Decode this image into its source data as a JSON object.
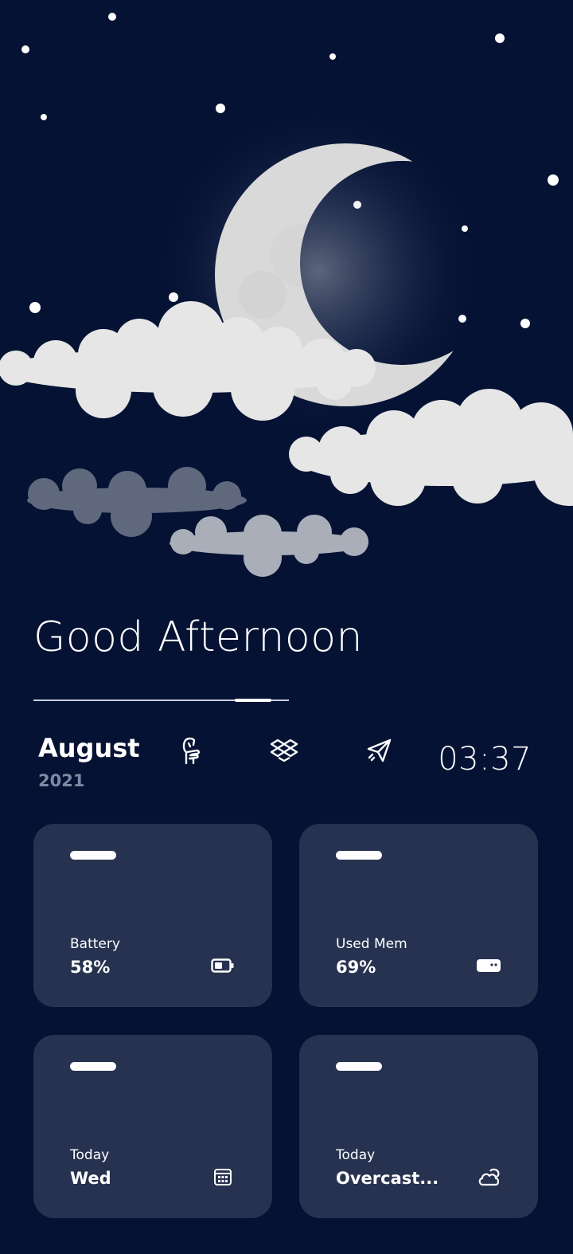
{
  "scene": {
    "description_icon": "crescent-moon-night-sky"
  },
  "greeting": "Good Afternoon",
  "progress": {
    "fraction": 0.86
  },
  "date": {
    "month": "August",
    "year": "2021"
  },
  "apps": [
    {
      "name": "finder-hand-icon"
    },
    {
      "name": "dropbox-icon"
    },
    {
      "name": "send-icon"
    }
  ],
  "clock": "03:37",
  "cards": [
    {
      "label": "Battery",
      "value": "58%",
      "icon": "battery-icon"
    },
    {
      "label": "Used Mem",
      "value": "69%",
      "icon": "memory-icon"
    },
    {
      "label": "Today",
      "value": "Wed",
      "icon": "calendar-icon"
    },
    {
      "label": "Today",
      "value": "Overcast...",
      "icon": "weather-cloud-icon"
    }
  ],
  "colors": {
    "background": "#051233",
    "card": "#26324f",
    "muted": "#7f8aa3",
    "accent": "#ffffff"
  }
}
